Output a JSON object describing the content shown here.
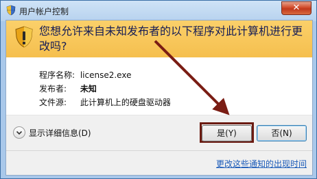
{
  "window": {
    "title": "用户帐户控制",
    "close_label": "✕"
  },
  "banner": {
    "question": "您想允许来自未知发布者的以下程序对此计算机进行更改吗?"
  },
  "info": {
    "rows": [
      {
        "label": "程序名称:",
        "value": "license2.exe"
      },
      {
        "label": "发布者:",
        "value": "未知"
      },
      {
        "label": "文件源:",
        "value": "此计算机上的硬盘驱动器"
      }
    ]
  },
  "footer": {
    "details_label": "显示详细信息(D)",
    "yes_label": "是(Y)",
    "no_label": "否(N)",
    "link_label": "更改这些通知的出现时间"
  },
  "colors": {
    "banner": "#f7c35b",
    "highlight": "#6b1b12",
    "link": "#1a5ab8"
  }
}
